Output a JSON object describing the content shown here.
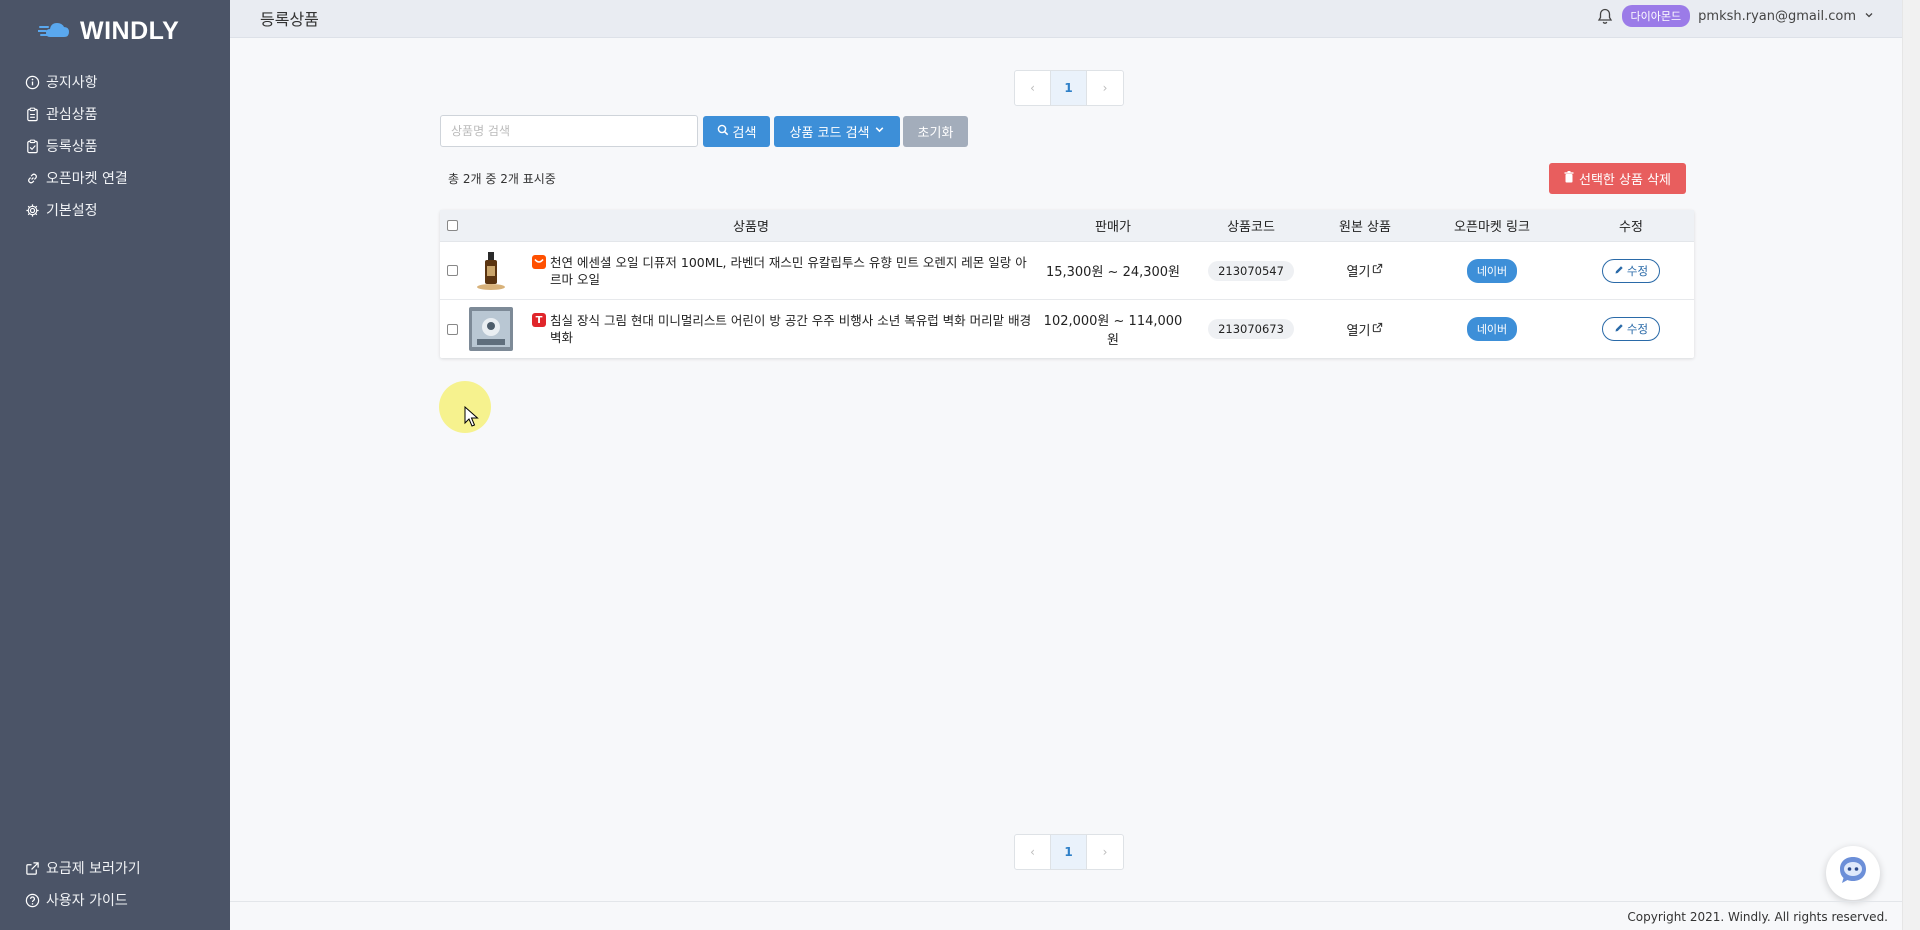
{
  "app": {
    "logo_text": "WINDLY"
  },
  "sidebar": {
    "items": [
      {
        "label": "공지사항",
        "icon": "info-icon"
      },
      {
        "label": "관심상품",
        "icon": "clipboard-icon"
      },
      {
        "label": "등록상품",
        "icon": "clipboard-check-icon"
      },
      {
        "label": "오픈마켓 연결",
        "icon": "link-icon"
      },
      {
        "label": "기본설정",
        "icon": "gear-icon"
      }
    ],
    "bottom_items": [
      {
        "label": "요금제 보러가기",
        "icon": "external-link-icon"
      },
      {
        "label": "사용자 가이드",
        "icon": "question-icon"
      }
    ]
  },
  "header": {
    "title": "등록상품",
    "tier_badge": "다이아몬드",
    "user_email": "pmksh.ryan@gmail.com"
  },
  "pagination": {
    "current": "1",
    "prev": "‹",
    "next": "›"
  },
  "search": {
    "placeholder": "상품명 검색",
    "value": "",
    "search_label": "검색",
    "code_search_label": "상품 코드 검색",
    "reset_label": "초기화"
  },
  "summary": {
    "count_text": "총 2개 중 2개 표시중",
    "delete_label": "선택한 상품 삭제"
  },
  "table": {
    "headers": {
      "name": "상품명",
      "price": "판매가",
      "code": "상품코드",
      "original": "원본 상품",
      "openmarket": "오픈마켓 링크",
      "edit": "수정"
    },
    "rows": [
      {
        "market_icon": "tmall-icon",
        "market_color": "#ff5000",
        "name": "천연 에센셜 오일 디퓨저 100ML, 라벤더 재스민 유칼립투스 유향 민트 오렌지 레몬 일랑 아르마 오일",
        "price": "15,300원 ~ 24,300원",
        "code": "213070547",
        "open_label": "열기",
        "market_link": "네이버",
        "edit_label": "수정"
      },
      {
        "market_icon": "taobao-icon",
        "market_color": "#e0262b",
        "market_glyph": "T",
        "name": "침실 장식 그림 현대 미니멀리스트 어린이 방 공간 우주 비행사 소년 복유럽 벽화 머리맡 배경 벽화",
        "price": "102,000원 ~ 114,000원",
        "code": "213070673",
        "open_label": "열기",
        "market_link": "네이버",
        "edit_label": "수정"
      }
    ]
  },
  "footer": {
    "copyright": "Copyright 2021. Windly. All rights reserved."
  },
  "colors": {
    "sidebar": "#4b5467",
    "primary": "#3d8fd8",
    "danger": "#e85e5e",
    "tier": "#9b7be8"
  }
}
